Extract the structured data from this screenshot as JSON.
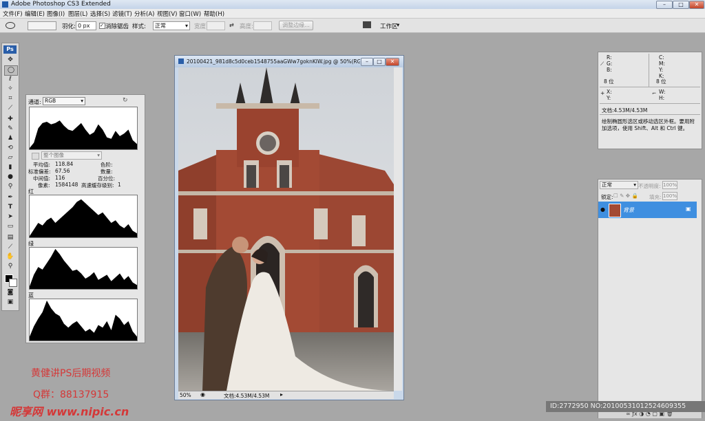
{
  "window": {
    "title": "Adobe Photoshop CS3 Extended"
  },
  "menu": [
    "文件(F)",
    "编辑(E)",
    "图像(I)",
    "图层(L)",
    "选择(S)",
    "滤镜(T)",
    "分析(A)",
    "视图(V)",
    "窗口(W)",
    "帮助(H)"
  ],
  "options": {
    "feather_label": "羽化:",
    "feather_value": "0 px",
    "antialias_label": "消除锯齿",
    "style_label": "样式:",
    "style_value": "正常",
    "width_label": "宽度:",
    "height_label": "高度:",
    "refine_edge": "调整边缘...",
    "workspace": "工作区"
  },
  "toolbox": {
    "logo": "Ps"
  },
  "histogram": {
    "channel_label": "通道:",
    "channel_value": "RGB",
    "source_value": "整个图像",
    "stats": {
      "mean_label": "平均值:",
      "mean": "118.84",
      "stddev_label": "标准偏差:",
      "stddev": "67.56",
      "median_label": "中间值:",
      "median": "116",
      "pixels_label": "像素:",
      "pixels": "1584148",
      "level_label": "色阶:",
      "count_label": "数量:",
      "percentile_label": "百分位:",
      "cache_label": "高速缓存级别:",
      "cache": "1"
    },
    "red_label": "红",
    "green_label": "绿",
    "blue_label": "蓝",
    "curves": {
      "rgb": [
        2,
        10,
        32,
        40,
        42,
        38,
        40,
        44,
        36,
        30,
        28,
        34,
        40,
        30,
        22,
        26,
        38,
        30,
        18,
        16,
        28,
        20,
        24,
        30,
        14,
        8
      ],
      "red": [
        2,
        12,
        22,
        18,
        26,
        30,
        22,
        28,
        34,
        40,
        46,
        54,
        58,
        52,
        46,
        40,
        34,
        38,
        30,
        22,
        26,
        18,
        14,
        20,
        10,
        6
      ],
      "green": [
        4,
        22,
        34,
        30,
        40,
        50,
        62,
        54,
        44,
        36,
        28,
        30,
        24,
        16,
        20,
        26,
        14,
        18,
        22,
        12,
        18,
        24,
        14,
        20,
        10,
        6
      ],
      "blue": [
        6,
        22,
        34,
        44,
        62,
        50,
        42,
        38,
        26,
        20,
        26,
        30,
        22,
        14,
        18,
        12,
        24,
        20,
        30,
        16,
        40,
        34,
        24,
        30,
        14,
        6
      ]
    }
  },
  "document": {
    "title": "20100421_981d8c5d0ceb1548755aaGWw7goknKIW.jpg @ 50%(RGB...",
    "zoom": "50%",
    "doc_size": "文档:4.53M/4.53M"
  },
  "info": {
    "r": "R:",
    "g": "G:",
    "b": "B:",
    "c": "C:",
    "m": "M:",
    "y": "Y:",
    "k": "K:",
    "bit_left": "8 位",
    "bit_right": "8 位",
    "x": "X:",
    "yy": "Y:",
    "w": "W:",
    "h": "H:",
    "doc": "文档:4.53M/4.53M",
    "hint": "绘制椭圆形选区或移动选区外框。要用附加选项，使用 Shift、Alt 和 Ctrl 键。"
  },
  "layers": {
    "blend": "正常",
    "opacity_label": "不透明度:",
    "opacity": "100%",
    "lock_label": "锁定:",
    "fill_label": "填充:",
    "fill": "100%",
    "layer_name": "背景"
  },
  "watermark": {
    "line1": "黄健讲PS后期视频",
    "line2": "Q群：88137915",
    "site": "昵享网 www.nipic.cn",
    "id": "ID:2772950 NO:20100531012524609355"
  },
  "colors": {
    "accent": "#3f8fe0",
    "watermark": "#d43838",
    "brick": "#a34a34"
  }
}
